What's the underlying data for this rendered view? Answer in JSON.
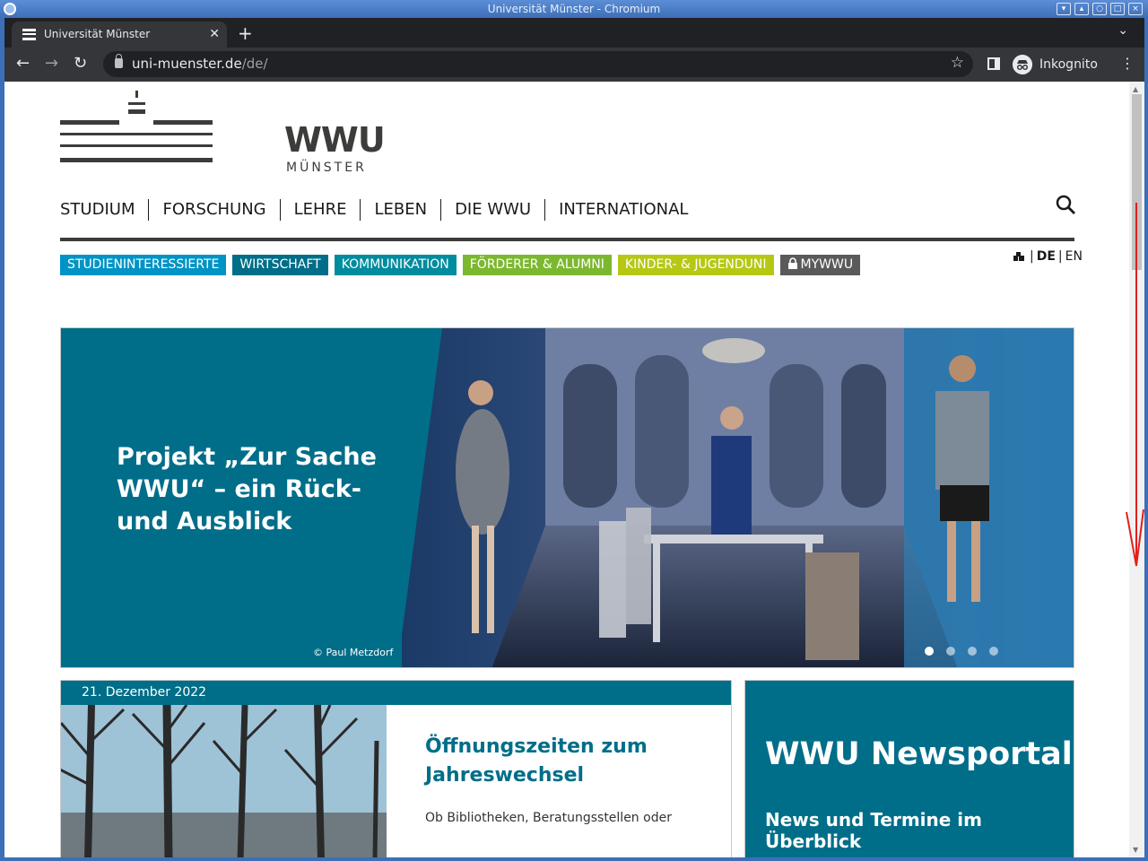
{
  "window": {
    "title": "Universität Münster - Chromium"
  },
  "browser": {
    "tab_title": "Universität Münster",
    "url_host": "uni-muenster.de",
    "url_path": "/de/",
    "profile_label": "Inkognito"
  },
  "site": {
    "logo": {
      "text": "WWU",
      "subtitle": "MÜNSTER"
    },
    "main_nav": [
      "STUDIUM",
      "FORSCHUNG",
      "LEHRE",
      "LEBEN",
      "DIE WWU",
      "INTERNATIONAL"
    ],
    "target_groups": [
      {
        "label": "STUDIENINTERESSIERTE",
        "color": "#0094c6"
      },
      {
        "label": "WIRTSCHAFT",
        "color": "#006e89"
      },
      {
        "label": "KOMMUNIKATION",
        "color": "#008c9e"
      },
      {
        "label": "FÖRDERER & ALUMNI",
        "color": "#7cb82f"
      },
      {
        "label": "KINDER- & JUGENDUNI",
        "color": "#b6c814"
      },
      {
        "label": "MYWWU",
        "color": "#5a5a5a"
      }
    ],
    "language": {
      "de": "DE",
      "en": "EN",
      "separator": "|"
    },
    "hero": {
      "title": "Projekt „Zur Sache WWU“ – ein Rück- und Ausblick",
      "credit": "© Paul Metzdorf",
      "slide_count": 4,
      "active_slide": 1
    },
    "news": {
      "date": "21. Dezember 2022",
      "title": "Öffnungszeiten zum Jahreswechsel",
      "teaser": "Ob Bibliotheken, Beratungsstellen oder"
    },
    "portal": {
      "title": "WWU Newsportal",
      "subtitle": "News und Termine im Überblick"
    }
  },
  "colors": {
    "brand_teal": "#006e89",
    "annotation": "#e0201c"
  }
}
